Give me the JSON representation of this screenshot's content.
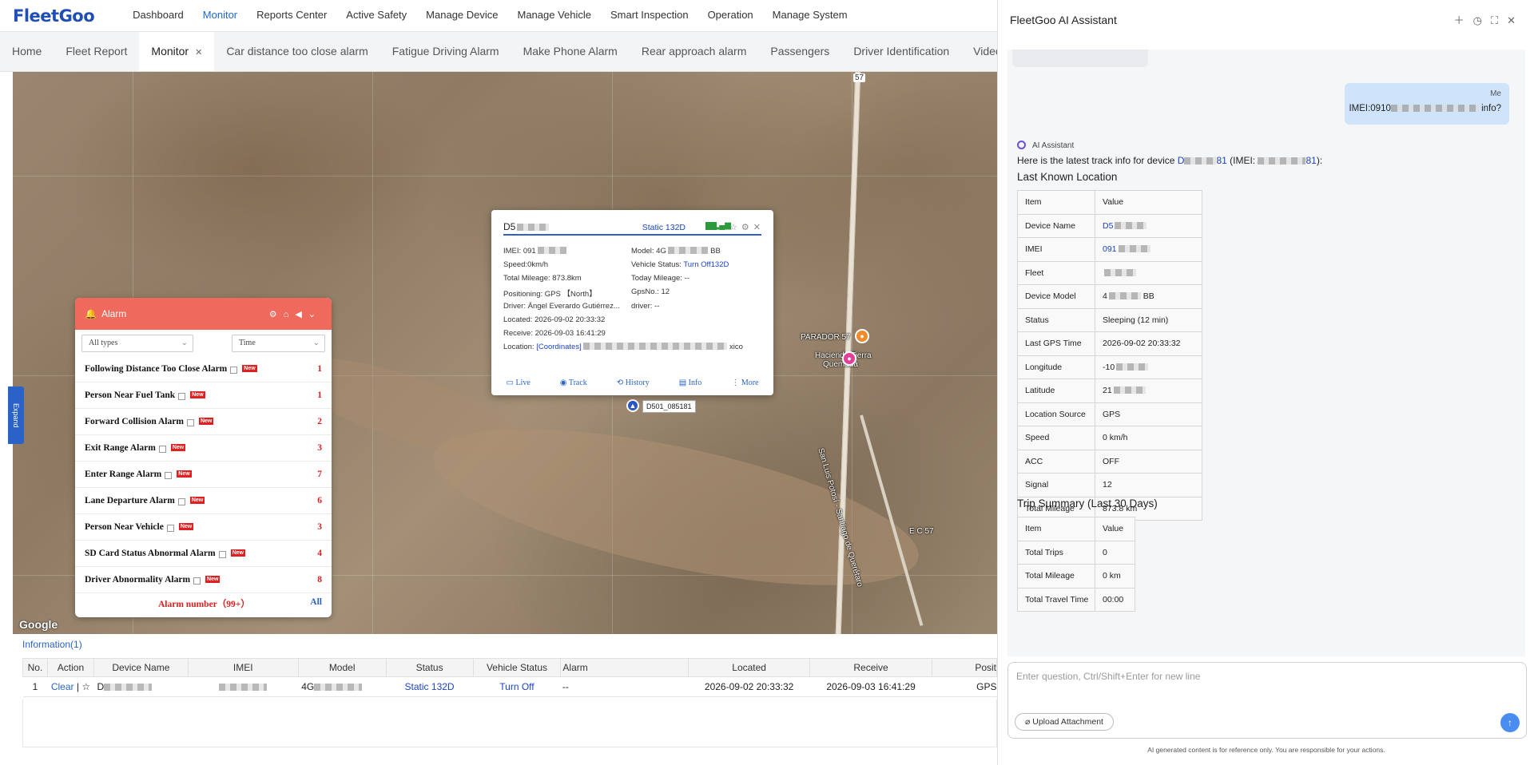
{
  "nav": {
    "logo": "FleetGoo",
    "items": [
      "Dashboard",
      "Monitor",
      "Reports Center",
      "Active Safety",
      "Manage Device",
      "Manage Vehicle",
      "Smart Inspection",
      "Operation",
      "Manage System"
    ],
    "active": "Monitor"
  },
  "tabs": [
    "Home",
    "Fleet Report",
    "Monitor",
    "Car distance too close alarm",
    "Fatigue Driving Alarm",
    "Make Phone Alarm",
    "Rear approach alarm",
    "Passengers",
    "Driver Identification",
    "Video Signal"
  ],
  "active_tab": "Monitor",
  "map": {
    "labels": {
      "parador": "PARADOR 57",
      "hacienda": "Hacienda Tierra",
      "quemada": "Quemada",
      "road": "San Luis Potosí - Santiago de Querétaro",
      "ec57": "E C 57",
      "hwy": "57"
    },
    "google": "Google",
    "device_label": "D501_085181"
  },
  "popup": {
    "title": "D5",
    "status": "Static 132D",
    "imei_label": "IMEI:",
    "imei": "091",
    "model_label": "Model:",
    "model": "4G",
    "model_tail": "BB",
    "speed_label": "Speed:",
    "speed": "0km/h",
    "vstatus_label": "Vehicle Status:",
    "vstatus": "Turn Off132D",
    "mileage_label": "Total Mileage:",
    "mileage": "873.8km",
    "today_label": "Today Mileage:",
    "today": "--",
    "positioning_label": "Positioning:",
    "positioning": "GPS 【North】",
    "gpsno_label": "GpsNo.:",
    "gpsno": "12",
    "driver_label": "Driver:",
    "driver": "Ángel Everardo Gutiérrez...",
    "driver2_label": "driver:",
    "driver2": "--",
    "located_label": "Located:",
    "located": "2026-09-02 20:33:32",
    "receive_label": "Receive:",
    "receive": "2026-09-03 16:41:29",
    "location_label": "Location:",
    "location_link": "[Coordinates]",
    "location_tail": "xico",
    "actions": [
      "Live",
      "Track",
      "History",
      "Info",
      "More"
    ]
  },
  "alarm": {
    "title": "Alarm",
    "filter_type": "All types",
    "filter_time": "Time",
    "rows": [
      {
        "name": "Following Distance Too Close Alarm",
        "count": "1"
      },
      {
        "name": "Person Near Fuel Tank",
        "count": "1"
      },
      {
        "name": "Forward Collision Alarm",
        "count": "2"
      },
      {
        "name": "Exit Range Alarm",
        "count": "3"
      },
      {
        "name": "Enter Range Alarm",
        "count": "7"
      },
      {
        "name": "Lane Departure Alarm",
        "count": "6"
      },
      {
        "name": "Person Near Vehicle",
        "count": "3"
      },
      {
        "name": "SD Card Status Abnormal Alarm",
        "count": "4"
      },
      {
        "name": "Driver Abnormality Alarm",
        "count": "8"
      }
    ],
    "new_badge": "New",
    "footer": "Alarm number（99+）",
    "all": "All"
  },
  "expand": "Expand",
  "info": {
    "title": "Information(1)",
    "headers": [
      "No.",
      "Action",
      "Device Name",
      "IMEI",
      "Model",
      "Status",
      "Vehicle Status",
      "Alarm",
      "Located",
      "Receive",
      "Posit"
    ],
    "row": {
      "no": "1",
      "clear": "Clear",
      "sep": "|",
      "device": "D",
      "model": "4G",
      "status": "Static 132D",
      "vehicle_status": "Turn Off",
      "alarm": "--",
      "located": "2026-09-02 20:33:32",
      "receive": "2026-09-03 16:41:29",
      "position": "GPS"
    }
  },
  "ai": {
    "title": "FleetGoo AI Assistant",
    "me_label": "Me",
    "me_text_start": "IMEI:0910",
    "me_text_end": "info?",
    "assistant_name": "AI Assistant",
    "intro_start": "Here is the latest track info for device ",
    "intro_dev_a": "D",
    "intro_dev_b": "81",
    "intro_mid": " (IMEI: ",
    "intro_imei_b": "81",
    "intro_end": "):",
    "section1": "Last Known Location",
    "table1_header": {
      "k": "Item",
      "v": "Value"
    },
    "table1": [
      {
        "k": "Device Name",
        "v": "D5"
      },
      {
        "k": "IMEI",
        "v": "091"
      },
      {
        "k": "Fleet",
        "v": ""
      },
      {
        "k": "Device Model",
        "v": "4",
        "tail": "BB"
      },
      {
        "k": "Status",
        "v": "Sleeping (12 min)"
      },
      {
        "k": "Last GPS Time",
        "v": "2026-09-02 20:33:32"
      },
      {
        "k": "Longitude",
        "v": "-10"
      },
      {
        "k": "Latitude",
        "v": "21"
      },
      {
        "k": "Location Source",
        "v": "GPS"
      },
      {
        "k": "Speed",
        "v": "0 km/h"
      },
      {
        "k": "ACC",
        "v": "OFF"
      },
      {
        "k": "Signal",
        "v": "12"
      },
      {
        "k": "Total Mileage",
        "v": "873.8 km"
      }
    ],
    "section2": "Trip Summary (Last 30 Days)",
    "table2_header": {
      "k": "Item",
      "v": "Value"
    },
    "table2": [
      {
        "k": "Total Trips",
        "v": "0"
      },
      {
        "k": "Total Mileage",
        "v": "0 km"
      },
      {
        "k": "Total Travel Time",
        "v": "00:00"
      }
    ],
    "input_placeholder": "Enter question, Ctrl/Shift+Enter for new line",
    "upload": "Upload Attachment",
    "disclaimer": "AI generated content is for reference only. You are responsible for your actions."
  }
}
